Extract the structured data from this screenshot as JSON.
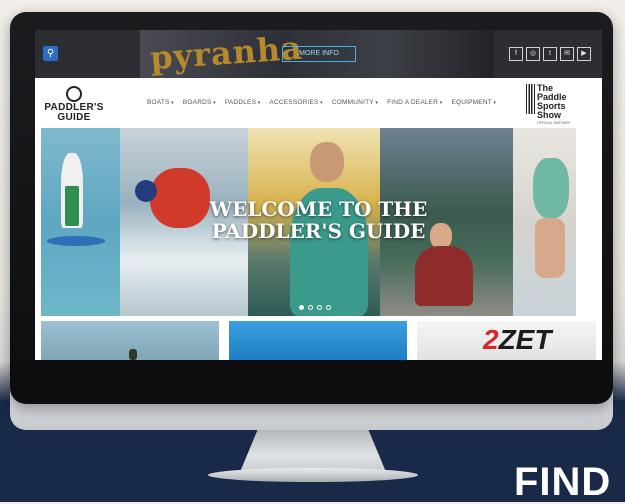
{
  "browser_page": {
    "ad_banner": {
      "brand": "pyranha",
      "button_label": "MORE INFO"
    },
    "social_icons": [
      "facebook-icon",
      "instagram-icon",
      "twitter-icon",
      "email-icon",
      "youtube-icon"
    ],
    "social_glyphs": [
      "f",
      "◎",
      "t",
      "✉",
      "▶"
    ],
    "logo": {
      "line1": "PADDLER'S",
      "line2": "GUIDE"
    },
    "nav": {
      "items": [
        "BOATS",
        "BOARDS",
        "PADDLES",
        "ACCESSORIES",
        "COMMUNITY",
        "FIND A DEALER",
        "EQUIPMENT"
      ]
    },
    "show_logo": {
      "line1": "The",
      "line2": "Paddle",
      "line3": "Sports",
      "line4": "Show",
      "sub": "OFFICIAL PARTNER"
    },
    "hero": {
      "title_line1": "WELCOME TO THE",
      "title_line2": "PADDLER'S GUIDE",
      "slide_index": 1,
      "slide_count": 4
    },
    "cards": {
      "card3_text_num": "2",
      "card3_text": "ZET"
    }
  },
  "overlay_text": "FIND",
  "colors": {
    "accent": "#2b6cc4",
    "topbar": "#2c2e33",
    "ad_button": "#41b3e6",
    "background_band": "#182a48"
  }
}
